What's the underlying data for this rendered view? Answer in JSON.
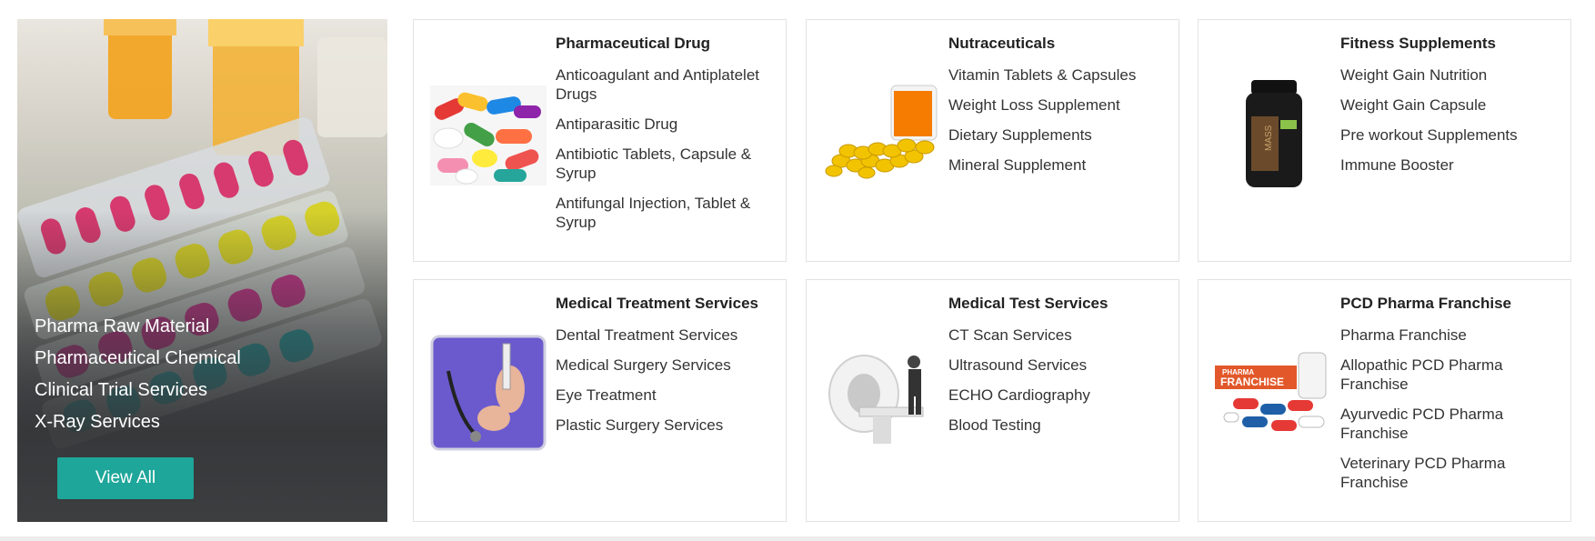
{
  "hero": {
    "items": [
      "Pharma Raw Material",
      "Pharmaceutical Chemical",
      "Clinical Trial Services",
      "X-Ray Services"
    ],
    "view_all_label": "View All",
    "button_color": "#1ea69a"
  },
  "cards": [
    {
      "title": "Pharmaceutical Drug",
      "image": "assorted-capsules-pills",
      "links": [
        "Anticoagulant and Antiplatelet Drugs",
        "Antiparasitic Drug",
        "Antibiotic Tablets, Capsule & Syrup",
        "Antifungal Injection, Tablet & Syrup"
      ]
    },
    {
      "title": "Nutraceuticals",
      "image": "softgel-capsules-bottle",
      "links": [
        "Vitamin Tablets & Capsules",
        "Weight Loss Supplement",
        "Dietary Supplements",
        "Mineral Supplement"
      ]
    },
    {
      "title": "Fitness Supplements",
      "image": "mass-gainer-jar",
      "links": [
        "Weight Gain Nutrition",
        "Weight Gain Capsule",
        "Pre workout Supplements",
        "Immune Booster"
      ]
    },
    {
      "title": "Medical Treatment Services",
      "image": "doctor-syringe",
      "links": [
        "Dental Treatment Services",
        "Medical Surgery Services",
        "Eye Treatment",
        "Plastic Surgery Services"
      ]
    },
    {
      "title": "Medical Test Services",
      "image": "ct-scanner",
      "links": [
        "CT Scan Services",
        "Ultrasound Services",
        "ECHO Cardiography",
        "Blood Testing"
      ]
    },
    {
      "title": "PCD Pharma Franchise",
      "image": "pharma-franchise-pills",
      "image_text": "PHARMA FRANCHISE",
      "links": [
        "Pharma Franchise",
        "Allopathic PCD Pharma Franchise",
        "Ayurvedic PCD Pharma Franchise",
        "Veterinary PCD Pharma Franchise"
      ]
    }
  ]
}
